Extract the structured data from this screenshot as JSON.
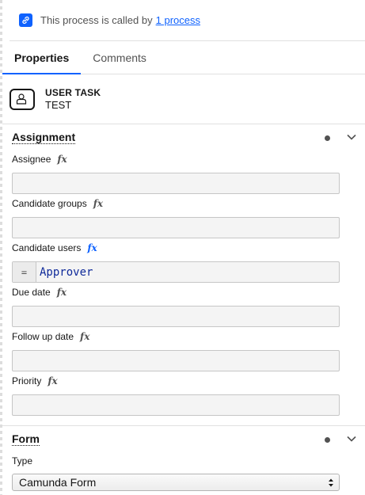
{
  "banner": {
    "text": "This process is called by",
    "link": "1 process",
    "icon": "link-icon"
  },
  "tabs": [
    {
      "label": "Properties",
      "active": true
    },
    {
      "label": "Comments",
      "active": false
    }
  ],
  "element": {
    "type": "USER TASK",
    "name": "TEST",
    "icon": "user-task-icon"
  },
  "assignment": {
    "title": "Assignment",
    "fields": {
      "assignee": {
        "label": "Assignee",
        "value": ""
      },
      "candidate_groups": {
        "label": "Candidate groups",
        "value": ""
      },
      "candidate_users": {
        "label": "Candidate users",
        "prefix": "=",
        "value": "Approver"
      },
      "due_date": {
        "label": "Due date",
        "value": ""
      },
      "follow_up_date": {
        "label": "Follow up date",
        "value": ""
      },
      "priority": {
        "label": "Priority",
        "value": ""
      }
    },
    "fx_label": "fx"
  },
  "form": {
    "title": "Form",
    "type_label": "Type",
    "type_value": "Camunda Form"
  },
  "colors": {
    "accent": "#0f62fe",
    "text": "#161616",
    "muted": "#525252",
    "input_bg": "#f4f4f4"
  }
}
